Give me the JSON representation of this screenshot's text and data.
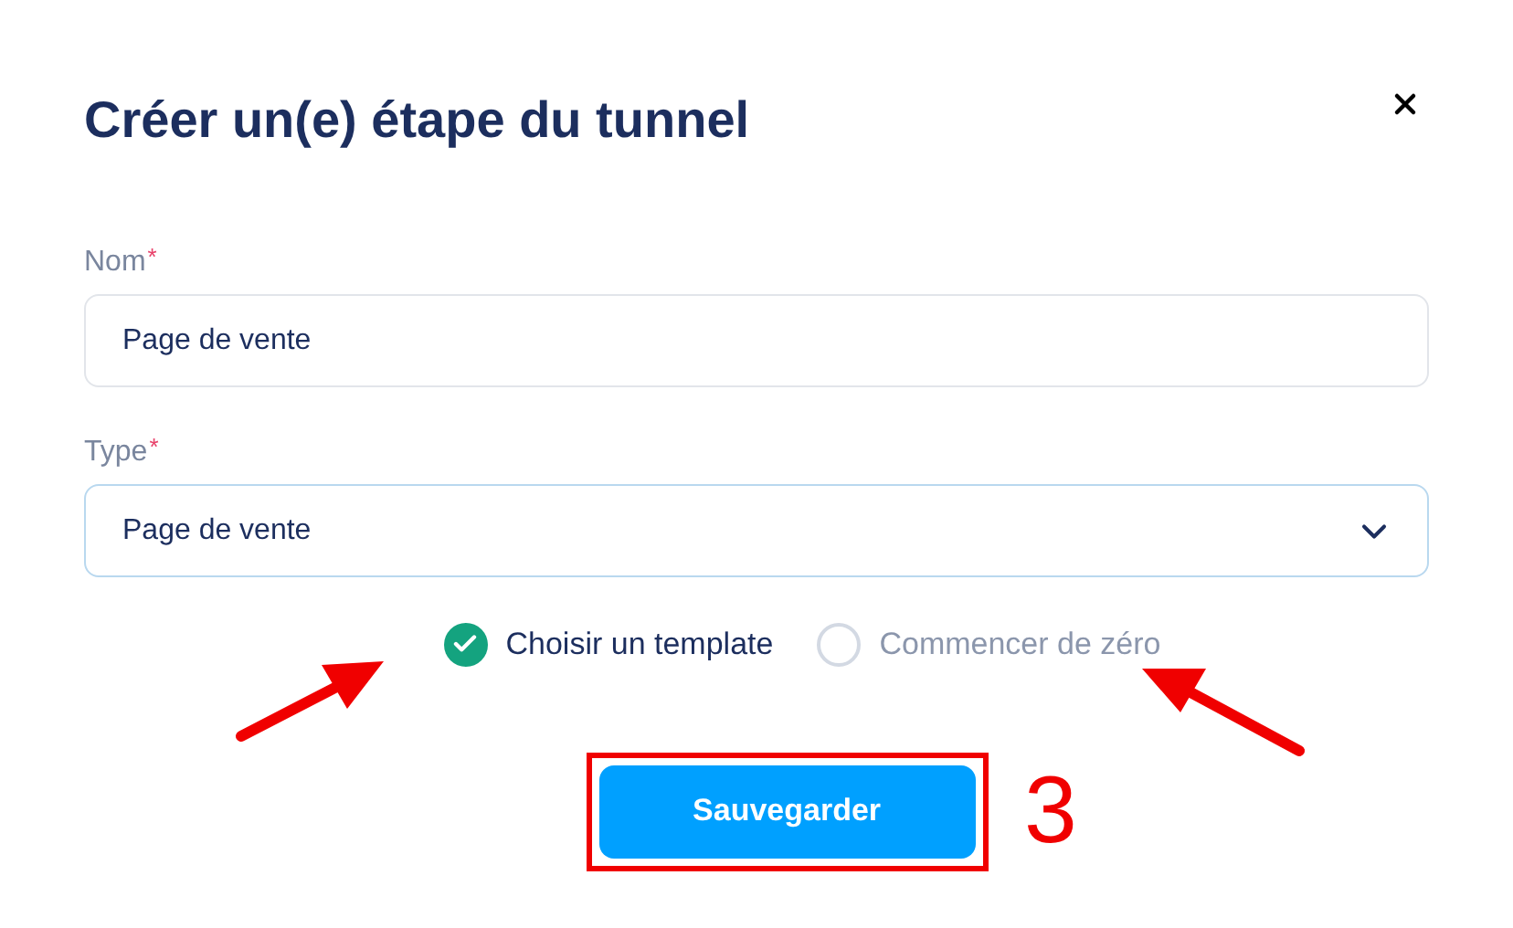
{
  "dialog": {
    "title": "Créer un(e) étape du tunnel"
  },
  "fields": [
    {
      "kind": "text",
      "label": "Nom",
      "required_mark": "*",
      "value": "Page de vente"
    },
    {
      "kind": "select",
      "label": "Type",
      "required_mark": "*",
      "value": "Page de vente"
    }
  ],
  "options": [
    {
      "label": "Choisir un template",
      "selected": true
    },
    {
      "label": "Commencer de zéro",
      "selected": false
    }
  ],
  "save_button": {
    "label": "Sauvegarder",
    "highlighted": true
  },
  "annotation": {
    "step": "3"
  }
}
